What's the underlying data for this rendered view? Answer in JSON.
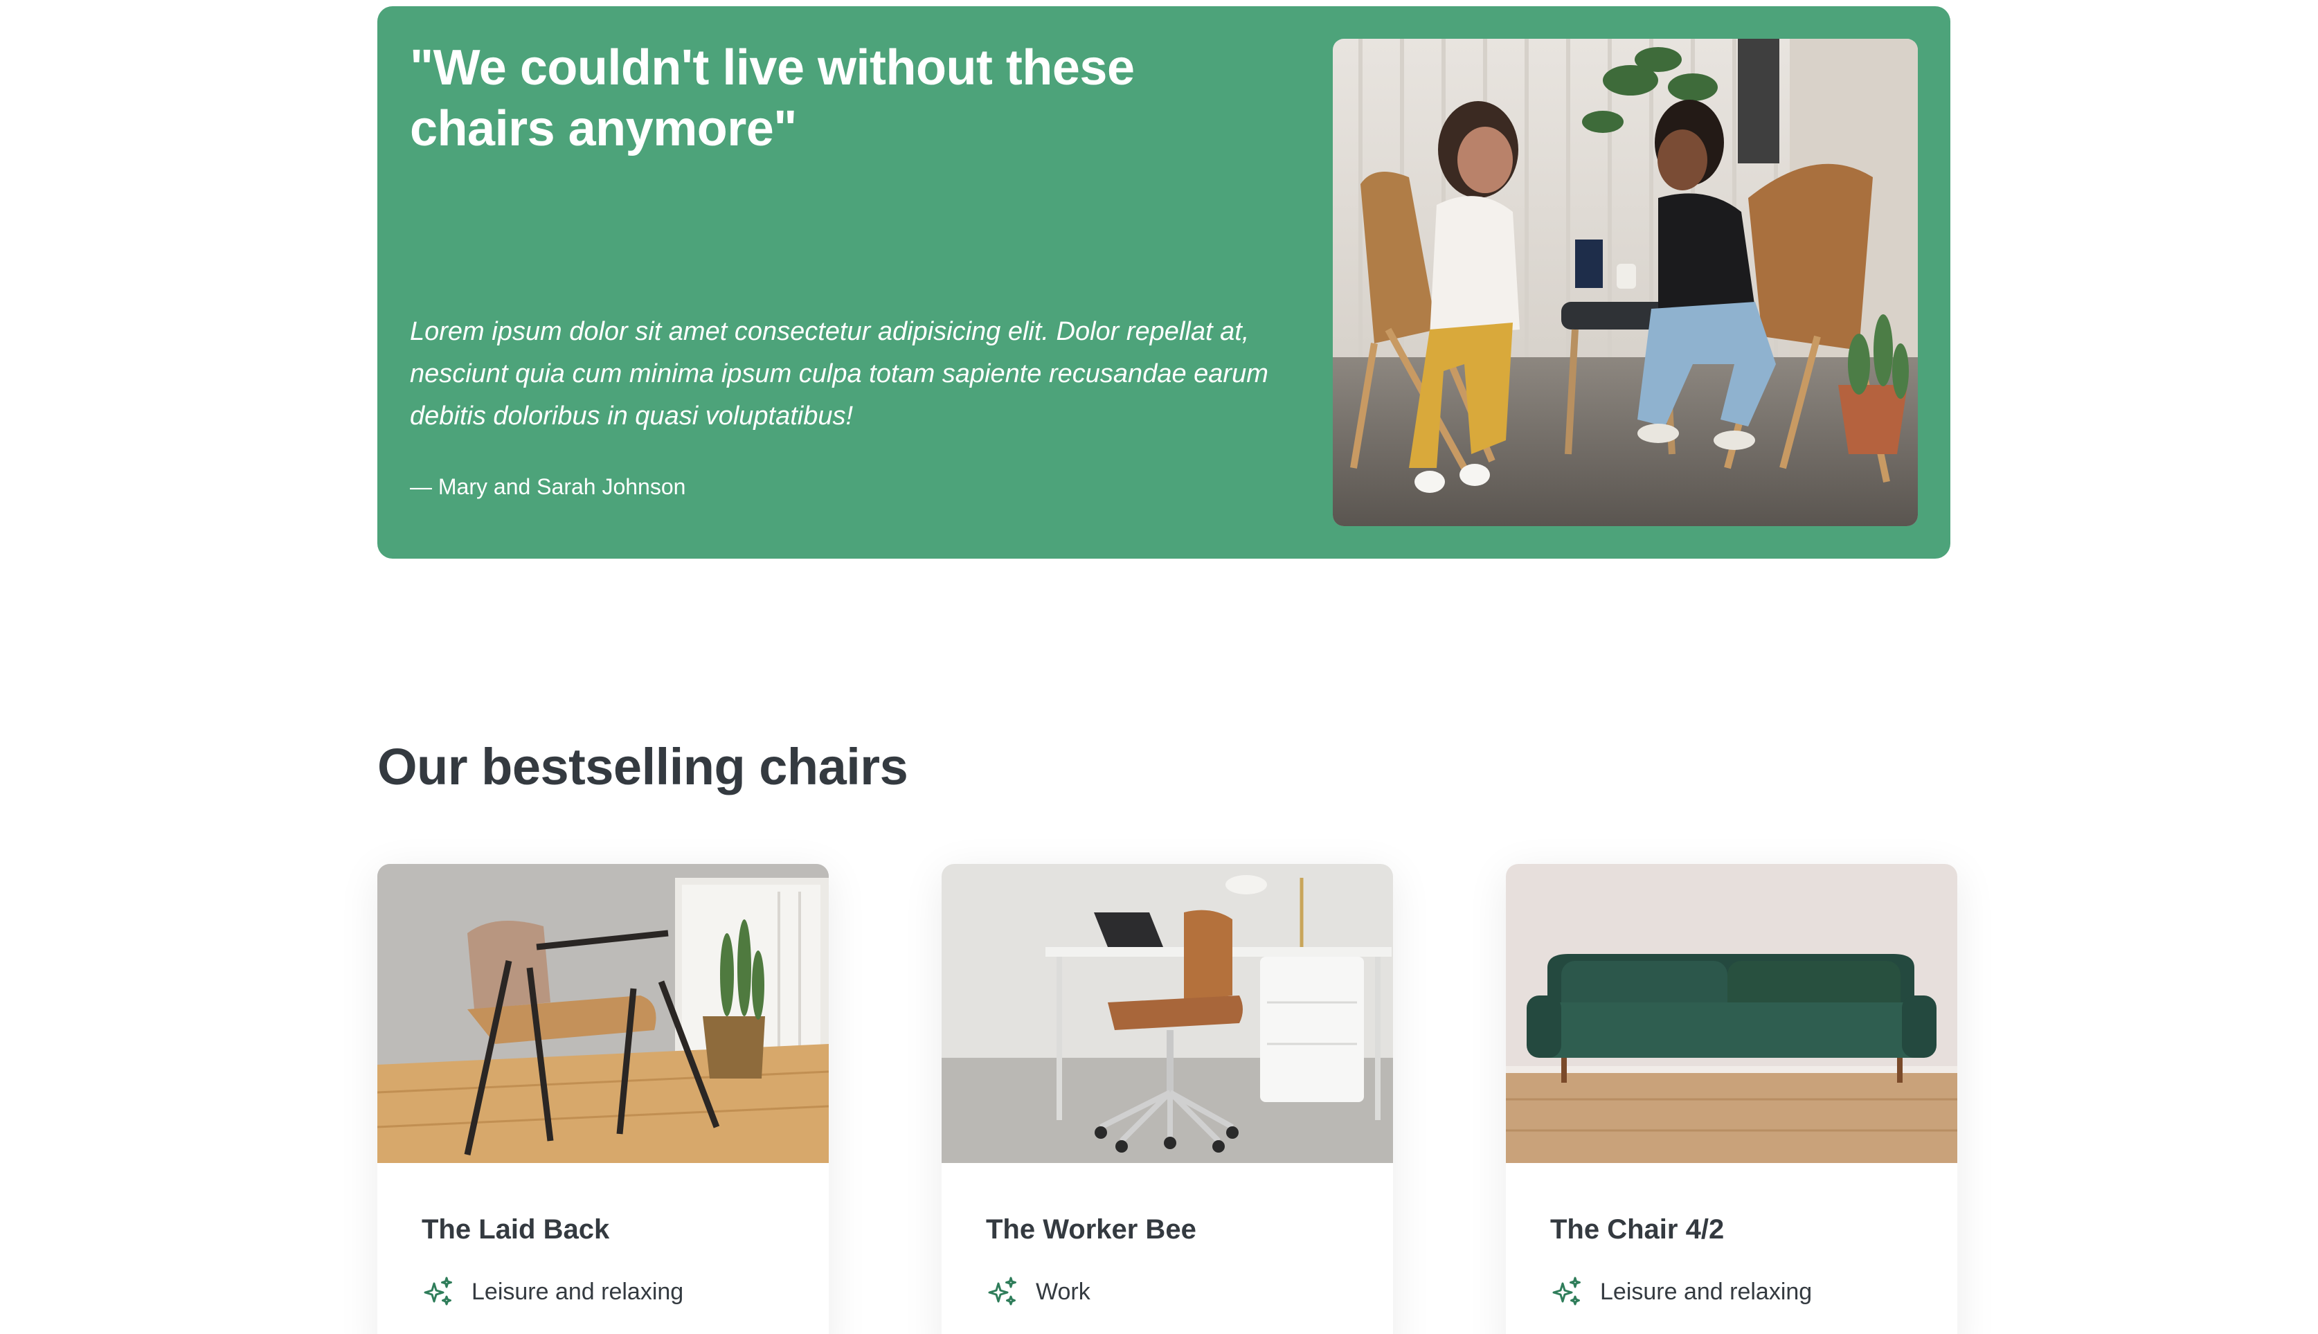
{
  "testimonial": {
    "quote": "\"We couldn't live without these chairs anymore\"",
    "text": "Lorem ipsum dolor sit amet consectetur adipisicing elit. Dolor repellat at, nesciunt quia cum minima ipsum culpa totam sapiente recusandae earum debitis doloribus in quasi voluptatibus!",
    "author": "— Mary and Sarah Johnson",
    "accent_color": "#4da37a"
  },
  "bestsellers": {
    "title": "Our bestselling chairs",
    "items": [
      {
        "name": "The Laid Back",
        "category": "Leisure and relaxing",
        "icon": "sparkles-icon"
      },
      {
        "name": "The Worker Bee",
        "category": "Work",
        "icon": "sparkles-icon"
      },
      {
        "name": "The Chair 4/2",
        "category": "Leisure and relaxing",
        "icon": "sparkles-icon"
      }
    ]
  },
  "colors": {
    "text": "#343a40",
    "icon": "#2f7d5a"
  }
}
